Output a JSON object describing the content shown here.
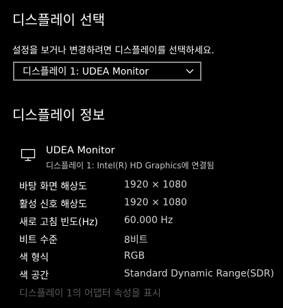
{
  "select_section": {
    "title": "디스플레이 선택",
    "description": "설정을 보거나 변경하려면 디스플레이를 선택하세요.",
    "dropdown_value": "디스플레이 1: UDEA Monitor"
  },
  "info_section": {
    "title": "디스플레이 정보",
    "monitor": {
      "icon": "monitor-icon",
      "name": "UDEA Monitor",
      "connection": "디스플레이 1: Intel(R) HD Graphics에 연결됨"
    },
    "rows": [
      {
        "label": "바탕 화면 해상도",
        "value": "1920 × 1080"
      },
      {
        "label": "활성 신호 해상도",
        "value": "1920 × 1080"
      },
      {
        "label": "새로 고침 빈도(Hz)",
        "value": "60.000 Hz"
      },
      {
        "label": "비트 수준",
        "value": "8비트"
      },
      {
        "label": "색 형식",
        "value": "RGB"
      },
      {
        "label": "색 공간",
        "value": "Standard Dynamic Range(SDR)"
      }
    ],
    "adapter_link": "디스플레이 1의 어댑터 속성을 표시"
  },
  "colors": {
    "background": "#000000",
    "text": "#ffffff",
    "secondary_text": "#c8c8c8",
    "disabled_link": "#5a5a5a",
    "dropdown_border": "#8c8c8c"
  }
}
